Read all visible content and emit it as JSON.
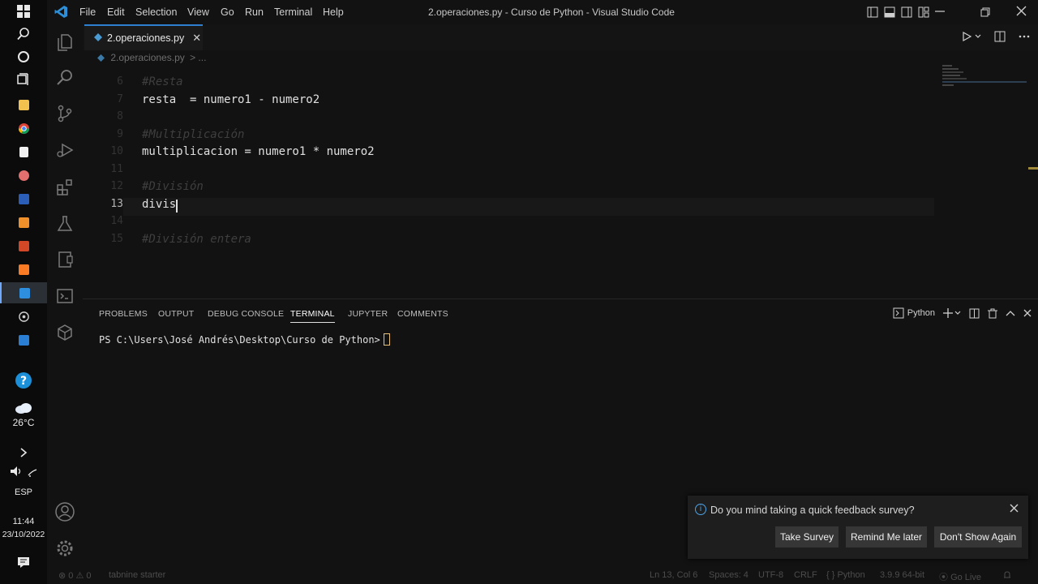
{
  "taskbar": {
    "weather_temp": "26°C",
    "language": "ESP",
    "time": "11:44",
    "date": "23/10/2022"
  },
  "titlebar": {
    "menus": [
      "File",
      "Edit",
      "Selection",
      "View",
      "Go",
      "Run",
      "Terminal",
      "Help"
    ],
    "window_title": "2.operaciones.py - Curso de Python - Visual Studio Code"
  },
  "tab": {
    "label": "2.operaciones.py",
    "close": "✕"
  },
  "breadcrumb": {
    "file": "2.operaciones.py",
    "more": "> ..."
  },
  "editor": {
    "lines": [
      {
        "num": "6",
        "text": "#Resta",
        "kind": "comment"
      },
      {
        "num": "7",
        "text": "resta  = numero1 - numero2",
        "kind": "code"
      },
      {
        "num": "8",
        "text": "",
        "kind": "code"
      },
      {
        "num": "9",
        "text": "#Multiplicación",
        "kind": "comment"
      },
      {
        "num": "10",
        "text": "multiplicacion = numero1 * numero2",
        "kind": "code"
      },
      {
        "num": "11",
        "text": "",
        "kind": "code"
      },
      {
        "num": "12",
        "text": "#División",
        "kind": "comment"
      },
      {
        "num": "13",
        "text": "divis",
        "kind": "current"
      },
      {
        "num": "14",
        "text": "",
        "kind": "code"
      },
      {
        "num": "15",
        "text": "#División entera",
        "kind": "comment"
      }
    ]
  },
  "panel": {
    "tabs": [
      "PROBLEMS",
      "OUTPUT",
      "DEBUG CONSOLE",
      "TERMINAL",
      "JUPYTER",
      "COMMENTS"
    ],
    "active_tab": "TERMINAL",
    "shell_label": "Python",
    "prompt": "PS C:\\Users\\José Andrés\\Desktop\\Curso de Python>"
  },
  "notification": {
    "message": "Do you mind taking a quick feedback survey?",
    "buttons": [
      "Take Survey",
      "Remind Me later",
      "Don't Show Again"
    ]
  },
  "statusbar": {
    "problems": "⊗ 0 ⚠ 0",
    "tabnine": "tabnine starter",
    "position": "Ln 13, Col 6",
    "spaces": "Spaces: 4",
    "encoding": "UTF-8",
    "eol": "CRLF",
    "language": "Python",
    "interpreter": "3.9.9 64-bit",
    "golive": "Go Live"
  }
}
